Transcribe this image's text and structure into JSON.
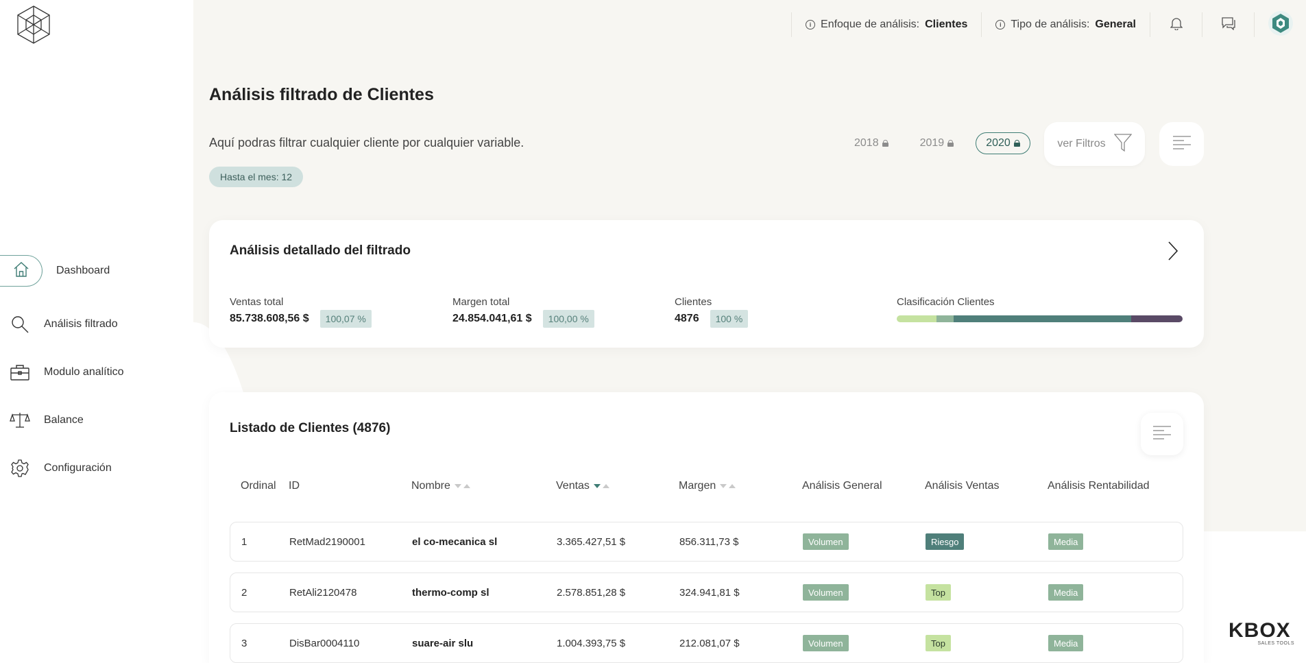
{
  "topbar": {
    "enfoque_label": "Enfoque de análisis:",
    "enfoque_value": "Clientes",
    "tipo_label": "Tipo de análisis:",
    "tipo_value": "General",
    "icons": [
      "info-icon",
      "bell-icon",
      "chat-icon",
      "avatar"
    ]
  },
  "sidebar": {
    "items": [
      {
        "label": "Dashboard",
        "icon": "home-icon",
        "active": true
      },
      {
        "label": "Análisis filtrado",
        "icon": "search-icon"
      },
      {
        "label": "Modulo analítico",
        "icon": "briefcase-icon"
      },
      {
        "label": "Balance",
        "icon": "scale-icon"
      },
      {
        "label": "Configuración",
        "icon": "gear-icon"
      }
    ]
  },
  "header": {
    "title": "Análisis filtrado de Clientes",
    "subtitle": "Aquí podras filtrar cualquier cliente por cualquier variable.",
    "month_chip": "Hasta el mes: 12",
    "years": [
      "2018",
      "2019",
      "2020"
    ],
    "active_year": "2020",
    "filter_label": "ver Filtros"
  },
  "detail": {
    "title": "Análisis detallado del filtrado",
    "ventas_label": "Ventas total",
    "ventas_value": "85.738.608,56 $",
    "ventas_pct": "100,07 %",
    "margen_label": "Margen total",
    "margen_value": "24.854.041,61 $",
    "margen_pct": "100,00 %",
    "clientes_label": "Clientes",
    "clientes_value": "4876",
    "clientes_pct": "100 %",
    "clasif_label": "Clasificación Clientes",
    "clasif_segments": [
      {
        "fraction": 0.14,
        "color": "#c5e2a0"
      },
      {
        "fraction": 0.06,
        "color": "#8fb49a"
      },
      {
        "fraction": 0.62,
        "color": "#4f7f7a"
      },
      {
        "fraction": 0.18,
        "color": "#5a4a66"
      }
    ]
  },
  "list": {
    "title": "Listado de Clientes (4876)",
    "columns": [
      "Ordinal",
      "ID",
      "Nombre",
      "Ventas",
      "Margen",
      "Análisis General",
      "Análisis Ventas",
      "Análisis Rentabilidad"
    ],
    "rows": [
      {
        "ordinal": "1",
        "id": "RetMad2190001",
        "nombre": "el co-mecanica sl",
        "ventas": "3.365.427,51 $",
        "margen": "856.311,73 $",
        "general": "Volumen",
        "ventas_tag": "Riesgo",
        "rent": "Media"
      },
      {
        "ordinal": "2",
        "id": "RetAli2120478",
        "nombre": "thermo-comp sl",
        "ventas": "2.578.851,28 $",
        "margen": "324.941,81 $",
        "general": "Volumen",
        "ventas_tag": "Top",
        "rent": "Media"
      },
      {
        "ordinal": "3",
        "id": "DisBar0004110",
        "nombre": "suare-air slu",
        "ventas": "1.004.393,75 $",
        "margen": "212.081,07 $",
        "general": "Volumen",
        "ventas_tag": "Top",
        "rent": "Media"
      }
    ]
  },
  "tag_colors": {
    "Volumen": "#8fb49a",
    "Riesgo": "#4f7f7a",
    "Top": "#c5e2a0",
    "Media": "#8fb49a"
  },
  "brand": {
    "name": "KBOX",
    "tagline": "SALES TOOLS"
  }
}
